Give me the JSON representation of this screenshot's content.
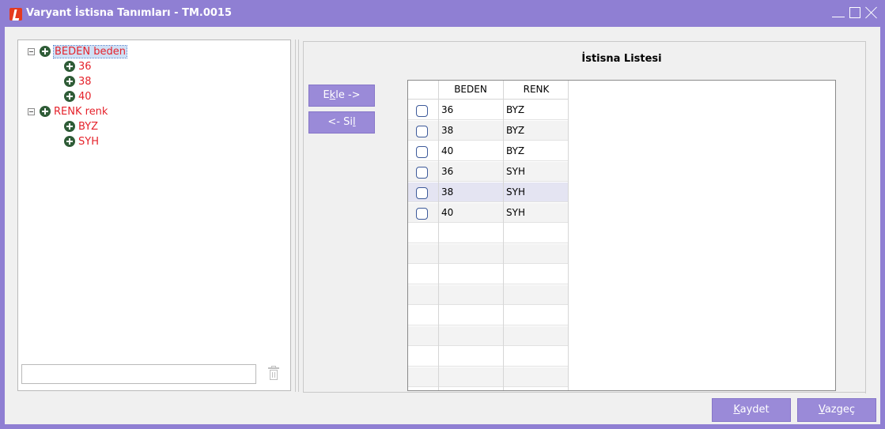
{
  "window": {
    "title": "Varyant İstisna Tanımları - TM.0015",
    "accent_color": "#8f7fd3",
    "controls": [
      "minimize-icon",
      "maximize-icon",
      "close-icon"
    ]
  },
  "tree": {
    "nodes": [
      {
        "label": "BEDEN beden",
        "selected": true,
        "children": [
          "36",
          "38",
          "40"
        ]
      },
      {
        "label": "RENK renk",
        "selected": false,
        "children": [
          "BYZ",
          "SYH"
        ]
      }
    ],
    "label_color": "#e5222b",
    "search_value": ""
  },
  "actions": {
    "add_pre": "E",
    "add_u": "k",
    "add_post": "le ->",
    "remove_pre": "<- Si",
    "remove_u": "l",
    "remove_post": ""
  },
  "exception_list": {
    "title": "İstisna Listesi",
    "columns": [
      "BEDEN",
      "RENK"
    ],
    "rows": [
      {
        "beden": "36",
        "renk": "BYZ",
        "checked": false
      },
      {
        "beden": "38",
        "renk": "BYZ",
        "checked": false
      },
      {
        "beden": "40",
        "renk": "BYZ",
        "checked": false
      },
      {
        "beden": "36",
        "renk": "SYH",
        "checked": false
      },
      {
        "beden": "38",
        "renk": "SYH",
        "checked": false
      },
      {
        "beden": "40",
        "renk": "SYH",
        "checked": false
      }
    ]
  },
  "footer": {
    "save_u": "K",
    "save_post": "aydet",
    "cancel_u": "V",
    "cancel_post": "azgeç"
  }
}
